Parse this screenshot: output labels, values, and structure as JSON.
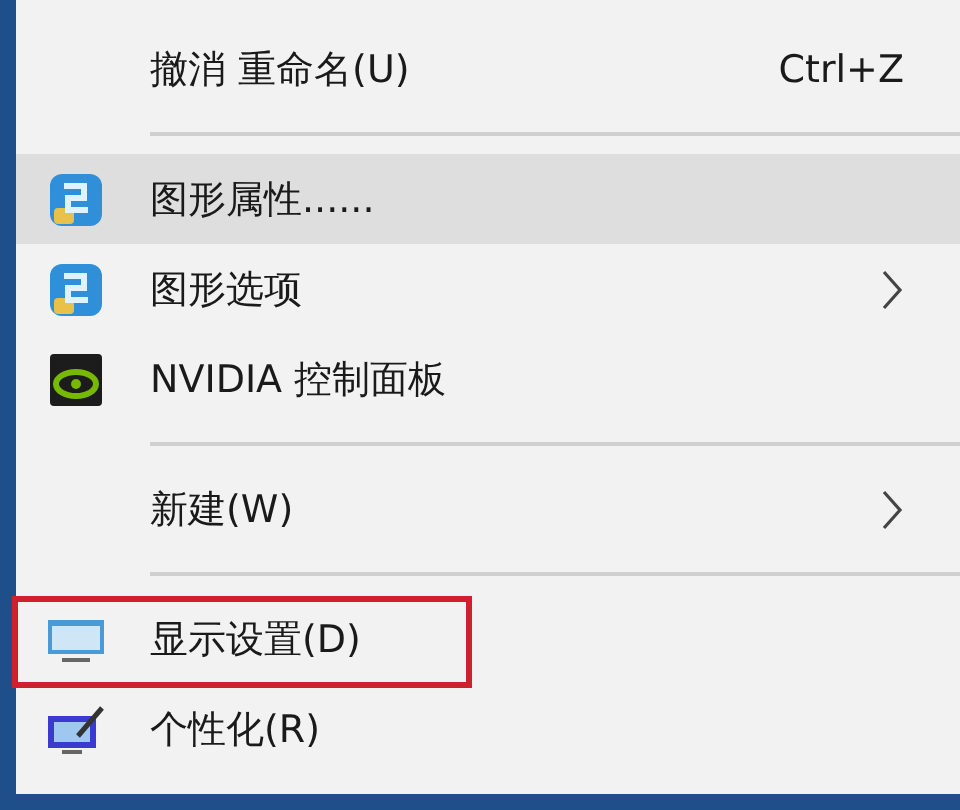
{
  "menu": {
    "items": [
      {
        "kind": "command",
        "label": "撤消 重命名(U)",
        "shortcut": "Ctrl+Z",
        "selected": false
      },
      {
        "kind": "separator"
      },
      {
        "kind": "command",
        "label": "图形属性......",
        "selected": true
      },
      {
        "kind": "command",
        "label": "图形选项",
        "submenu": true,
        "selected": false
      },
      {
        "kind": "command",
        "label": "NVIDIA 控制面板",
        "selected": false
      },
      {
        "kind": "separator"
      },
      {
        "kind": "command",
        "label": "新建(W)",
        "submenu": true,
        "selected": false
      },
      {
        "kind": "separator"
      },
      {
        "kind": "command",
        "label": "显示设置(D)",
        "annotated": true,
        "selected": false
      },
      {
        "kind": "command",
        "label": "个性化(R)",
        "selected": false
      }
    ]
  }
}
